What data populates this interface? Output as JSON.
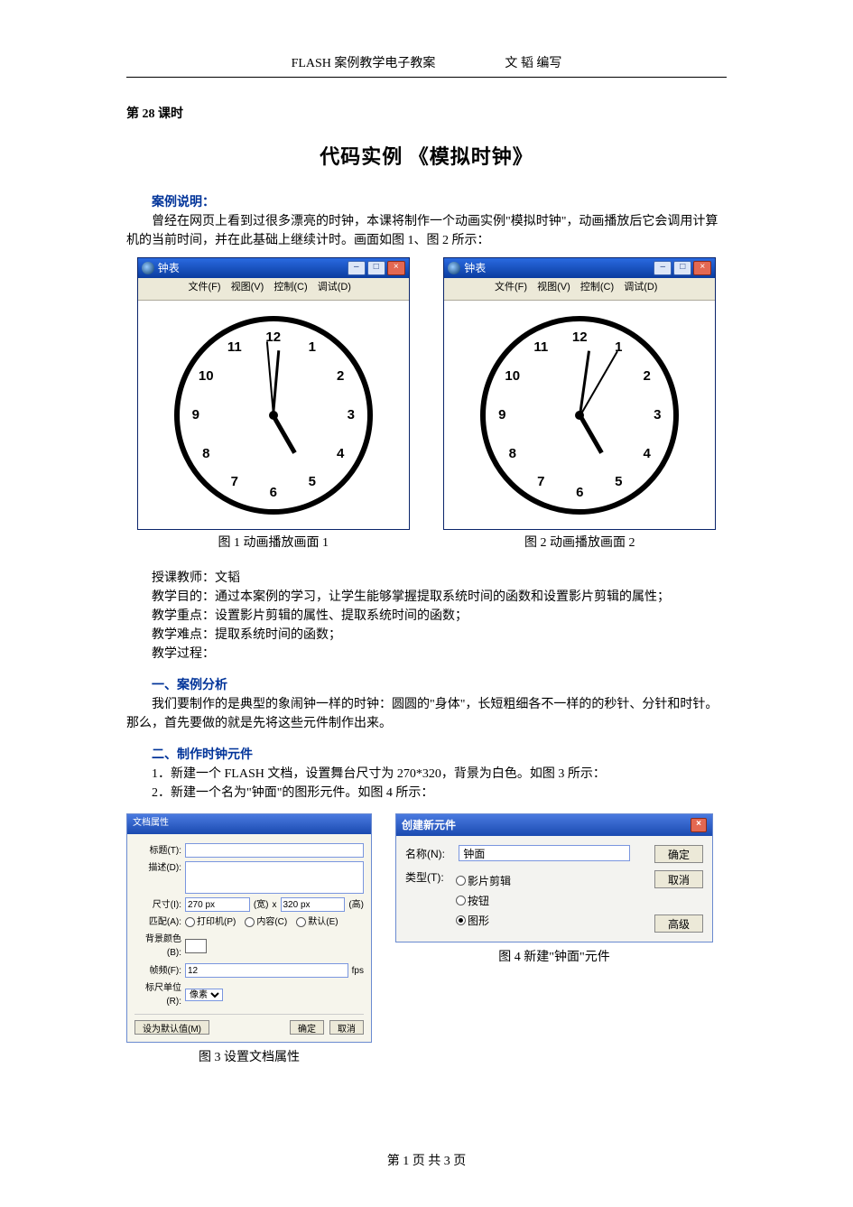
{
  "header": {
    "left": "FLASH 案例教学电子教案",
    "right": "文 韬  编写"
  },
  "lesson": "第 28 课时",
  "title": "代码实例  《模拟时钟》",
  "sec_case_label": "案例说明：",
  "case_p1": "曾经在网页上看到过很多漂亮的时钟，本课将制作一个动画实例\"模拟时钟\"，动画播放后它会调用计算机的当前时间，并在此基础上继续计时。画面如图 1、图 2 所示：",
  "flash_win": {
    "title": "钟表",
    "menu": {
      "file": "文件(F)",
      "view": "视图(V)",
      "control": "控制(C)",
      "debug": "调试(D)"
    },
    "clock_numbers": [
      "12",
      "1",
      "2",
      "3",
      "4",
      "5",
      "6",
      "7",
      "8",
      "9",
      "10",
      "11"
    ]
  },
  "clock1": {
    "hour_deg": 150,
    "min_deg": 5,
    "sec_deg": 355
  },
  "clock2": {
    "hour_deg": 150,
    "min_deg": 8,
    "sec_deg": 30
  },
  "cap_fig1": "图 1 动画播放画面 1",
  "cap_fig2": "图 2 动画播放画面 2",
  "teacher_line": "授课教师：文韬",
  "goal_line": "教学目的：通过本案例的学习，让学生能够掌握提取系统时间的函数和设置影片剪辑的属性；",
  "focus_line": "教学重点：设置影片剪辑的属性、提取系统时间的函数；",
  "hard_line": "教学难点：提取系统时间的函数；",
  "proc_line": "教学过程：",
  "sec1_label": "一、案例分析",
  "sec1_p": "我们要制作的是典型的象闹钟一样的时钟：圆圆的\"身体\"，长短粗细各不一样的的秒针、分针和时针。那么，首先要做的就是先将这些元件制作出来。",
  "sec2_label": "二、制作时钟元件",
  "sec2_l1": "1．新建一个 FLASH 文档，设置舞台尺寸为 270*320，背景为白色。如图 3 所示：",
  "sec2_l2": "2．新建一个名为\"钟面\"的图形元件。如图 4 所示：",
  "dlg3": {
    "title": "文档属性",
    "lbl_title": "标题(T):",
    "val_title": "",
    "lbl_desc": "描述(D):",
    "lbl_size": "尺寸(I):",
    "w": "270 px",
    "x": "x",
    "h": "320 px",
    "w_hint": "(宽)",
    "h_hint": "(高)",
    "lbl_match": "匹配(A):",
    "m1": "打印机(P)",
    "m2": "内容(C)",
    "m3": "默认(E)",
    "lbl_bg": "背景颜色(B):",
    "lbl_fps": "帧频(F):",
    "fps": "12",
    "fps_unit": "fps",
    "lbl_ruler": "标尺单位(R):",
    "ruler": "像素",
    "default_btn": "设为默认值(M)",
    "ok": "确定",
    "cancel": "取消"
  },
  "cap_fig3": "图 3  设置文档属性",
  "dlg4": {
    "title": "创建新元件",
    "lbl_name": "名称(N):",
    "name": "钟面",
    "lbl_type": "类型(T):",
    "t1": "影片剪辑",
    "t2": "按钮",
    "t3": "图形",
    "ok": "确定",
    "cancel": "取消",
    "adv": "高级"
  },
  "cap_fig4": "图 4  新建\"钟面\"元件",
  "footer": "第 1 页 共 3 页"
}
